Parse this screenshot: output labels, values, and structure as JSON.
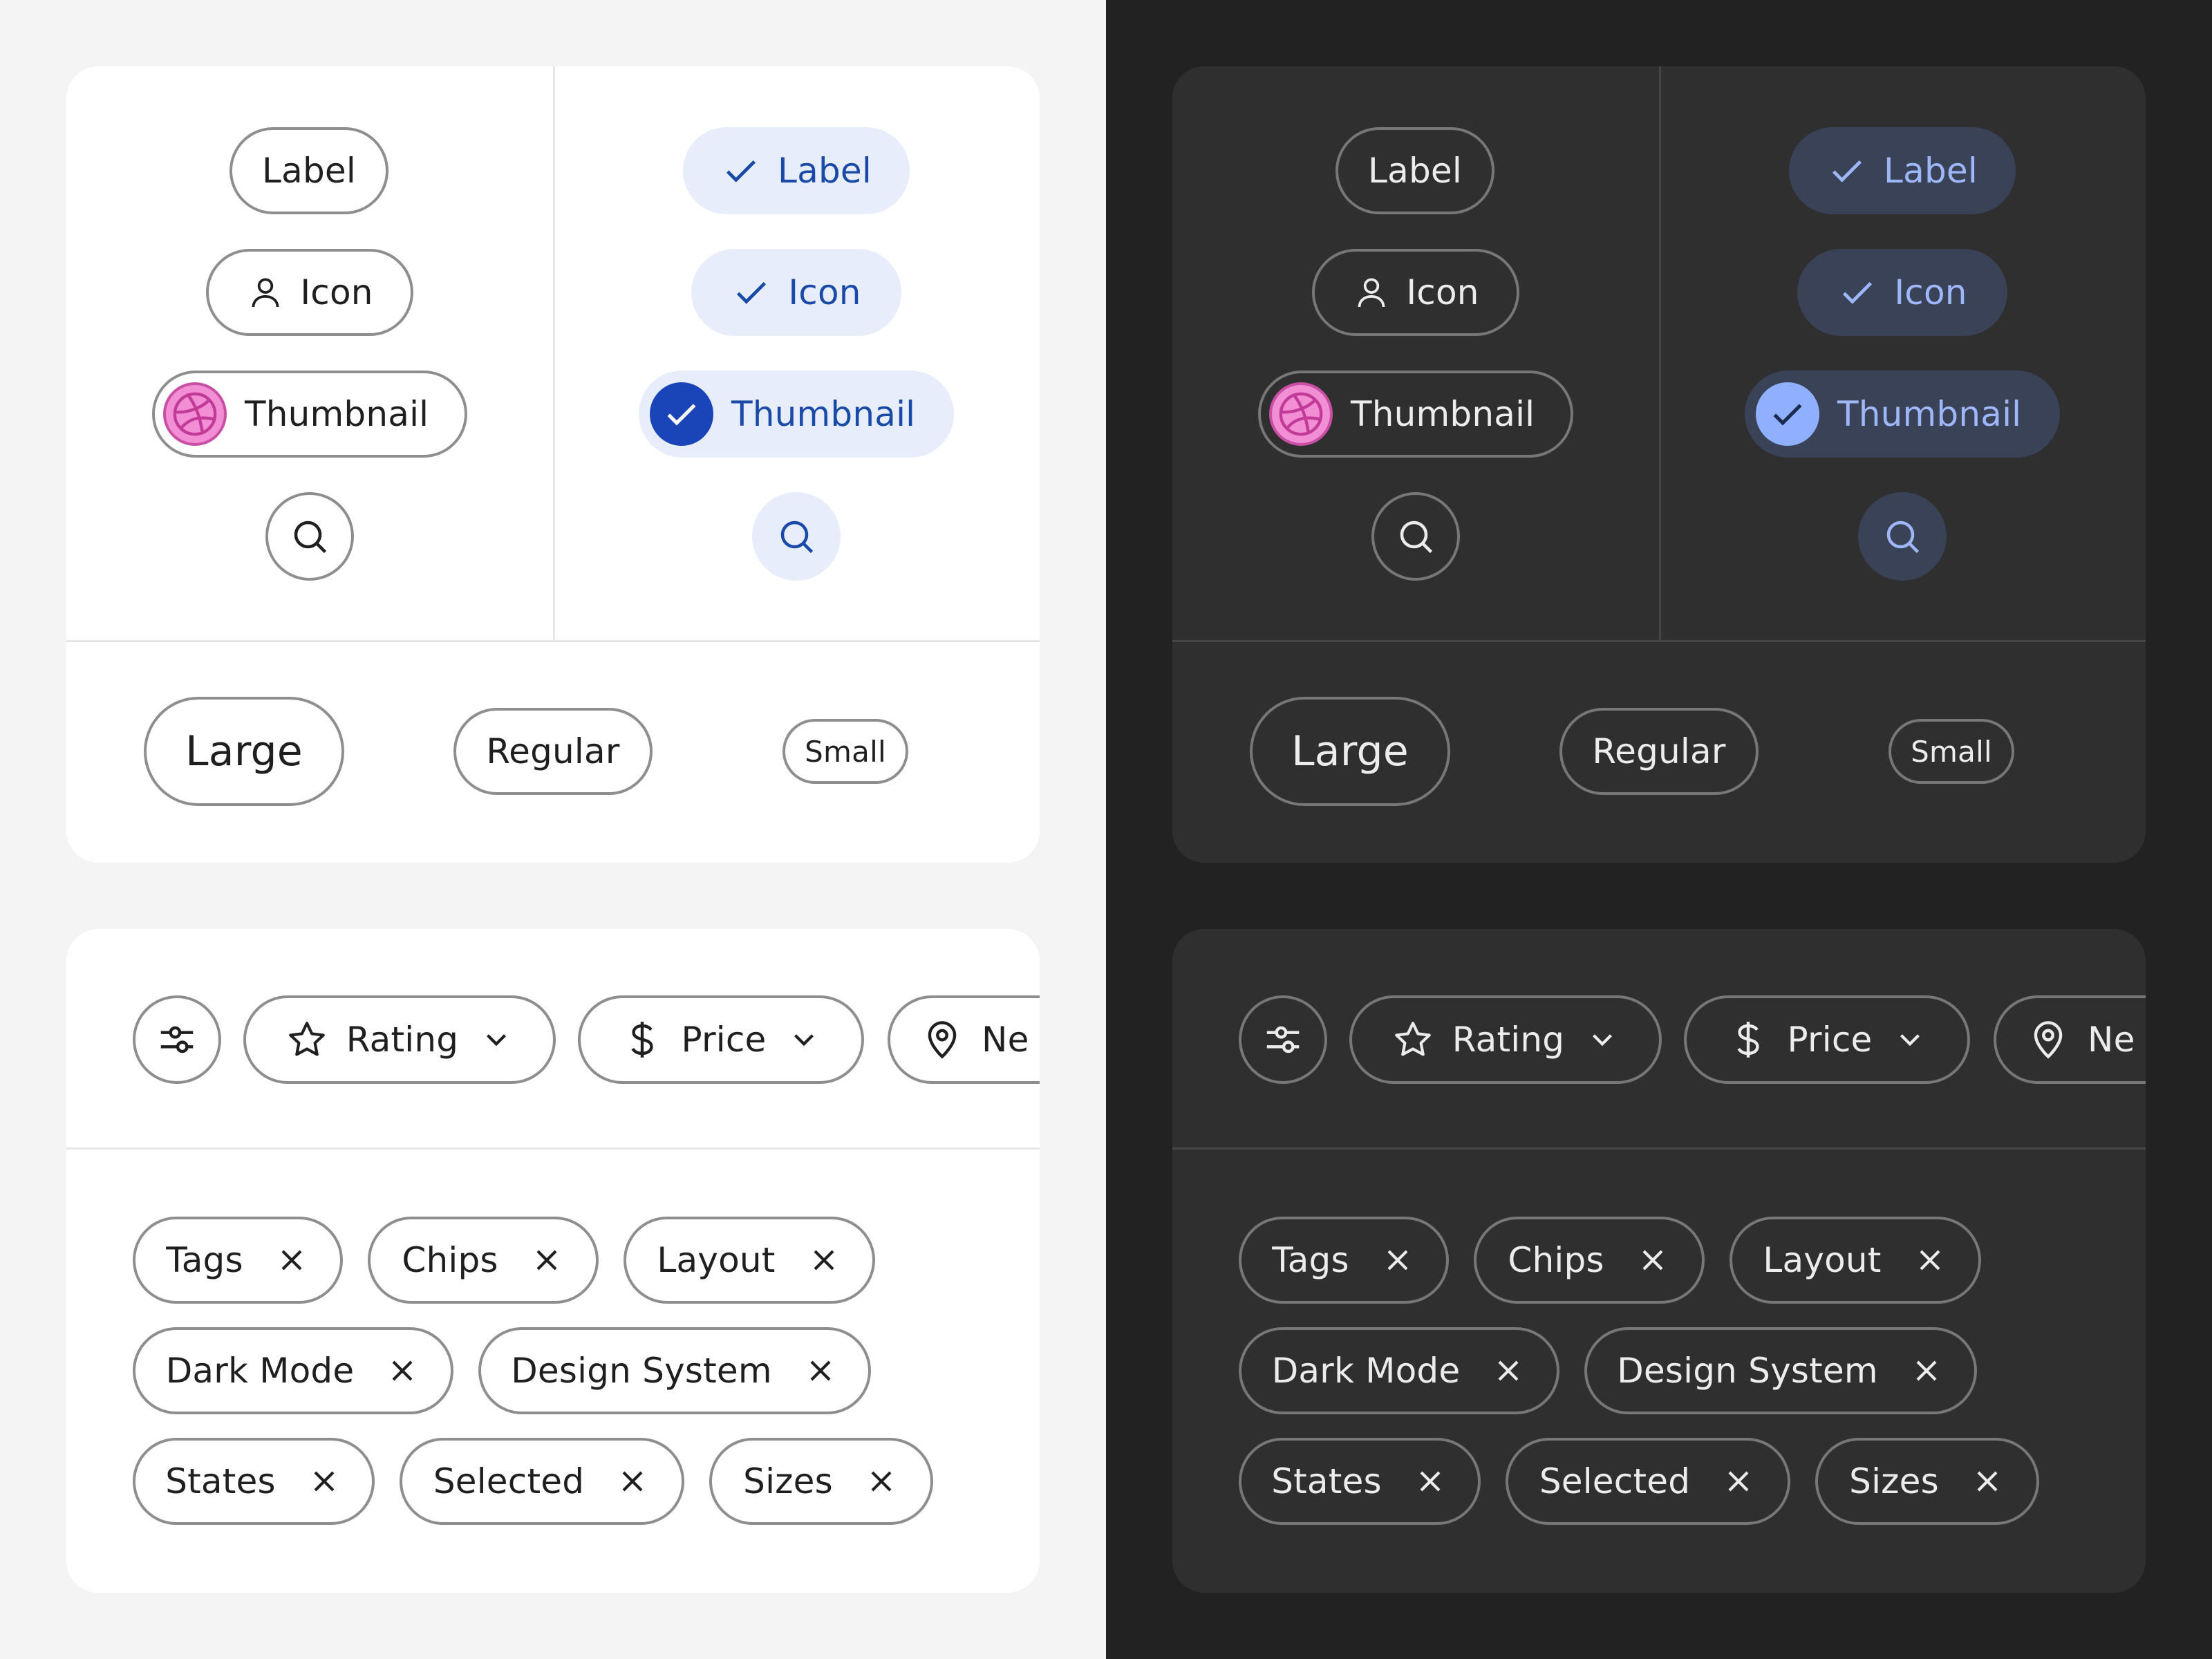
{
  "palette": {
    "selected_light": "#e7edfb",
    "selected_dark": "#3a4257",
    "thumbnail_accent": "#f18ed4"
  },
  "themes": [
    {
      "id": "light",
      "variants": {
        "unselected": {
          "label": "Label",
          "icon": "Icon",
          "thumbnail": "Thumbnail",
          "icon_only": "search-icon"
        },
        "selected": {
          "label": "Label",
          "icon": "Icon",
          "thumbnail": "Thumbnail",
          "icon_only": "search-icon"
        }
      },
      "sizes": {
        "large": "Large",
        "regular": "Regular",
        "small": "Small"
      },
      "filters": {
        "rating": "Rating",
        "price": "Price",
        "nearby": "Ne"
      },
      "tags": [
        "Tags",
        "Chips",
        "Layout",
        "Dark Mode",
        "Design System",
        "States",
        "Selected",
        "Sizes"
      ]
    },
    {
      "id": "dark",
      "variants": {
        "unselected": {
          "label": "Label",
          "icon": "Icon",
          "thumbnail": "Thumbnail",
          "icon_only": "search-icon"
        },
        "selected": {
          "label": "Label",
          "icon": "Icon",
          "thumbnail": "Thumbnail",
          "icon_only": "search-icon"
        }
      },
      "sizes": {
        "large": "Large",
        "regular": "Regular",
        "small": "Small"
      },
      "filters": {
        "rating": "Rating",
        "price": "Price",
        "nearby": "Ne"
      },
      "tags": [
        "Tags",
        "Chips",
        "Layout",
        "Dark Mode",
        "Design System",
        "States",
        "Selected",
        "Sizes"
      ]
    }
  ]
}
